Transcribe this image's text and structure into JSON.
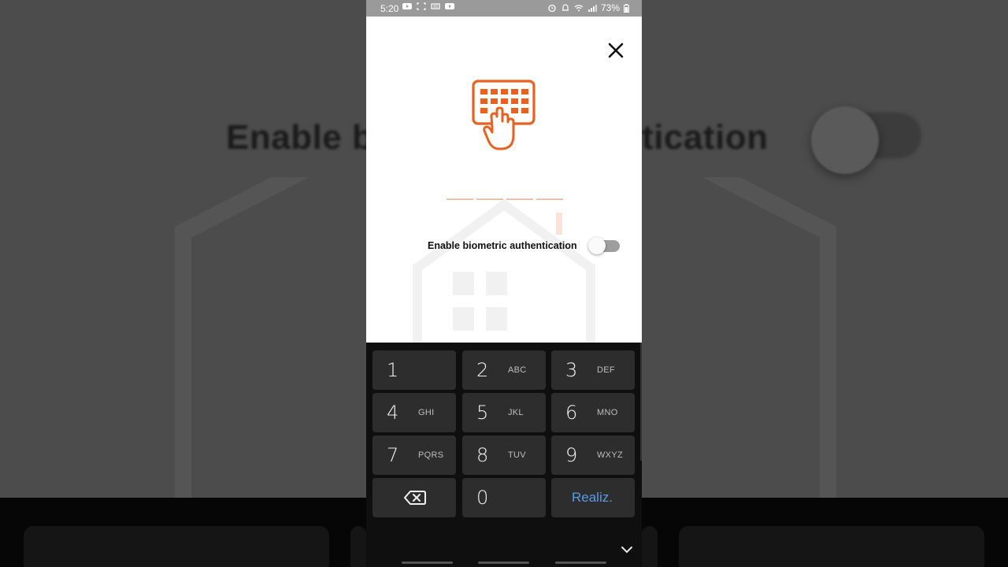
{
  "background": {
    "title_partial_left": "Enable b",
    "title_partial_right": "tication"
  },
  "status_bar": {
    "time": "5:20",
    "battery": "73%",
    "left_icons": [
      "youtube-icon",
      "screenshot-icon",
      "cast-icon",
      "youtube-icon"
    ],
    "right_icons": [
      "alarm-icon",
      "notification-icon",
      "wifi-icon",
      "signal-icon",
      "battery-icon"
    ]
  },
  "screen": {
    "close_icon": "close-icon",
    "logo_icon": "keypad-touch-icon",
    "pin_length": 4,
    "accent_color": "#e8611e",
    "biometric_label": "Enable biometric authentication",
    "biometric_enabled": false
  },
  "keyboard": {
    "keys": [
      {
        "num": "1",
        "letters": ""
      },
      {
        "num": "2",
        "letters": "ABC"
      },
      {
        "num": "3",
        "letters": "DEF"
      },
      {
        "num": "4",
        "letters": "GHI"
      },
      {
        "num": "5",
        "letters": "JKL"
      },
      {
        "num": "6",
        "letters": "MNO"
      },
      {
        "num": "7",
        "letters": "PQRS"
      },
      {
        "num": "8",
        "letters": "TUV"
      },
      {
        "num": "9",
        "letters": "WXYZ"
      }
    ],
    "zero": "0",
    "done_label": "Realiz.",
    "done_color": "#5a9be8",
    "backspace_icon": "backspace-icon",
    "collapse_icon": "chevron-down-icon"
  }
}
